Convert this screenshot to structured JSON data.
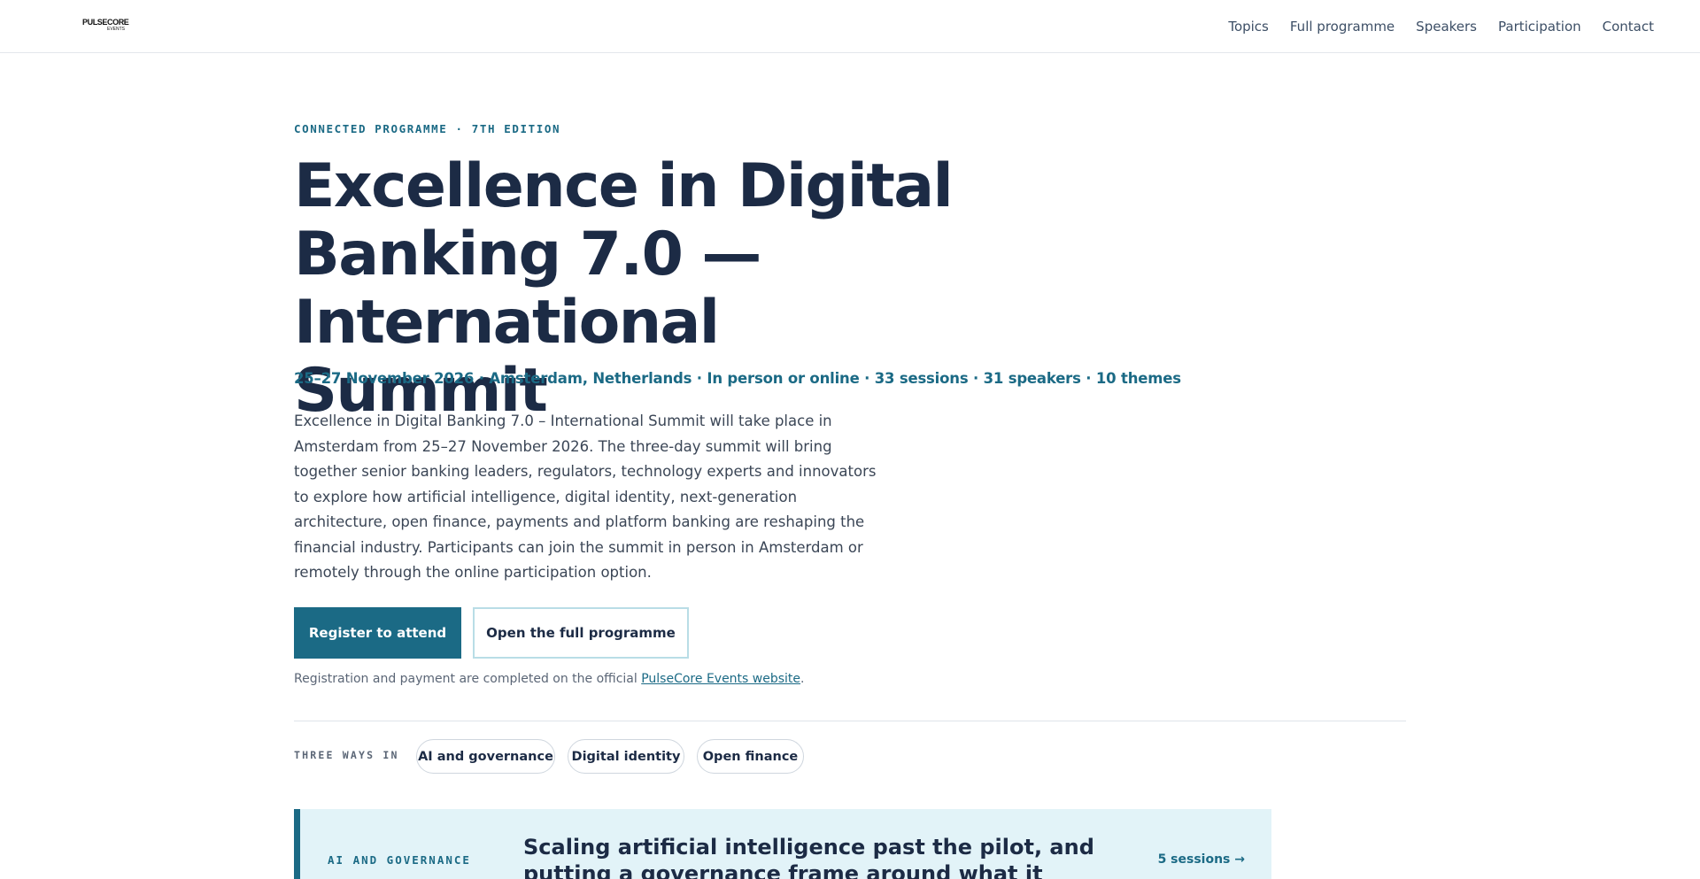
{
  "header": {
    "logo_line1": "PULSECORE",
    "logo_line2": "EVENTS",
    "nav": [
      "Topics",
      "Full programme",
      "Speakers",
      "Participation",
      "Contact"
    ]
  },
  "hero": {
    "kicker": "CONNECTED PROGRAMME · 7TH EDITION",
    "title": "Excellence in Digital Banking 7.0 — International Summit",
    "meta": "25–27 November 2026 · Amsterdam, Netherlands · In person or online · 33 sessions · 31 speakers · 10 themes",
    "description": "Excellence in Digital Banking 7.0 – International Summit will take place in Amsterdam from 25–27 November 2026. The three-day summit will bring together senior banking leaders, regulators, technology experts and innovators to explore how artificial intelligence, digital identity, next-generation architecture, open finance, payments and platform banking are reshaping the financial industry. Participants can join the summit in person in Amsterdam or remotely through the online participation option.",
    "primary_button": "Register to attend",
    "secondary_button": "Open the full programme",
    "regnote_prefix": "Registration and payment are completed on the official ",
    "regnote_link": "PulseCore Events website",
    "regnote_suffix": "."
  },
  "ways": {
    "label": "THREE WAYS IN",
    "pills": [
      "AI and governance",
      "Digital identity",
      "Open finance"
    ]
  },
  "feature_card": {
    "label": "AI AND GOVERNANCE",
    "title": "Scaling artificial intelligence past the pilot, and putting a governance frame around what it decides",
    "link": "5 sessions →"
  },
  "colors": {
    "accent": "#1b6a85",
    "heading": "#1c2b45",
    "card_bg": "#e2f3f8"
  }
}
